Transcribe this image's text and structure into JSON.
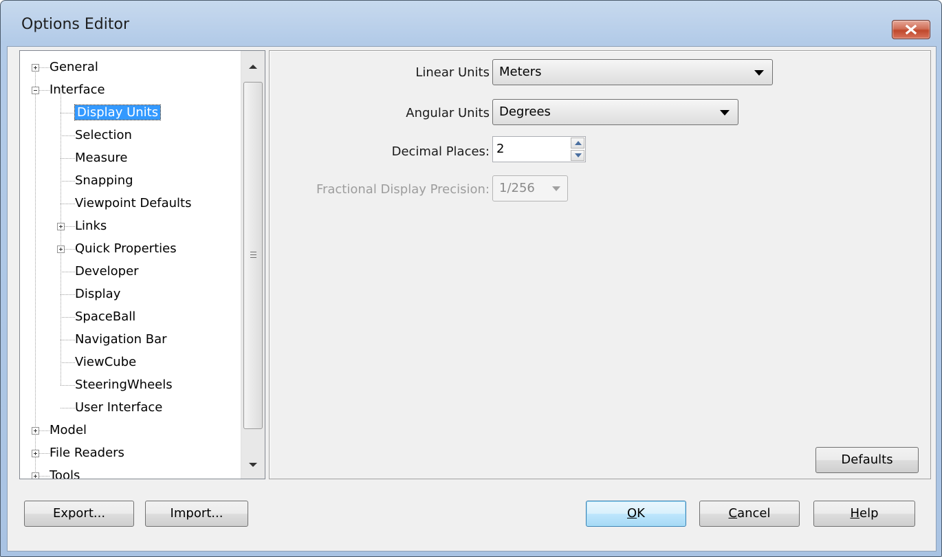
{
  "window": {
    "title": "Options Editor"
  },
  "tree": {
    "items": [
      {
        "label": "General",
        "level": 0,
        "expander": "plus"
      },
      {
        "label": "Interface",
        "level": 0,
        "expander": "minus"
      },
      {
        "label": "Display Units",
        "level": 1,
        "selected": true
      },
      {
        "label": "Selection",
        "level": 1
      },
      {
        "label": "Measure",
        "level": 1
      },
      {
        "label": "Snapping",
        "level": 1
      },
      {
        "label": "Viewpoint Defaults",
        "level": 1
      },
      {
        "label": "Links",
        "level": 1,
        "expander": "plus"
      },
      {
        "label": "Quick Properties",
        "level": 1,
        "expander": "plus"
      },
      {
        "label": "Developer",
        "level": 1
      },
      {
        "label": "Display",
        "level": 1
      },
      {
        "label": "SpaceBall",
        "level": 1
      },
      {
        "label": "Navigation Bar",
        "level": 1
      },
      {
        "label": "ViewCube",
        "level": 1
      },
      {
        "label": "SteeringWheels",
        "level": 1
      },
      {
        "label": "User Interface",
        "level": 1
      },
      {
        "label": "Model",
        "level": 0,
        "expander": "plus"
      },
      {
        "label": "File Readers",
        "level": 0,
        "expander": "plus"
      },
      {
        "label": "Tools",
        "level": 0,
        "expander": "plus"
      }
    ]
  },
  "form": {
    "linear_units": {
      "label": "Linear Units",
      "value": "Meters"
    },
    "angular_units": {
      "label": "Angular Units",
      "value": "Degrees"
    },
    "decimal_places": {
      "label": "Decimal Places:",
      "value": "2"
    },
    "fractional_precision": {
      "label": "Fractional Display Precision:",
      "value": "1/256"
    },
    "defaults_label": "Defaults"
  },
  "footer": {
    "export_label": "Export...",
    "import_label": "Import...",
    "ok_label": "OK",
    "ok_mnemonic": "O",
    "ok_rest": "K",
    "cancel_mnemonic": "C",
    "cancel_rest": "ancel",
    "help_mnemonic": "H",
    "help_rest": "elp"
  }
}
